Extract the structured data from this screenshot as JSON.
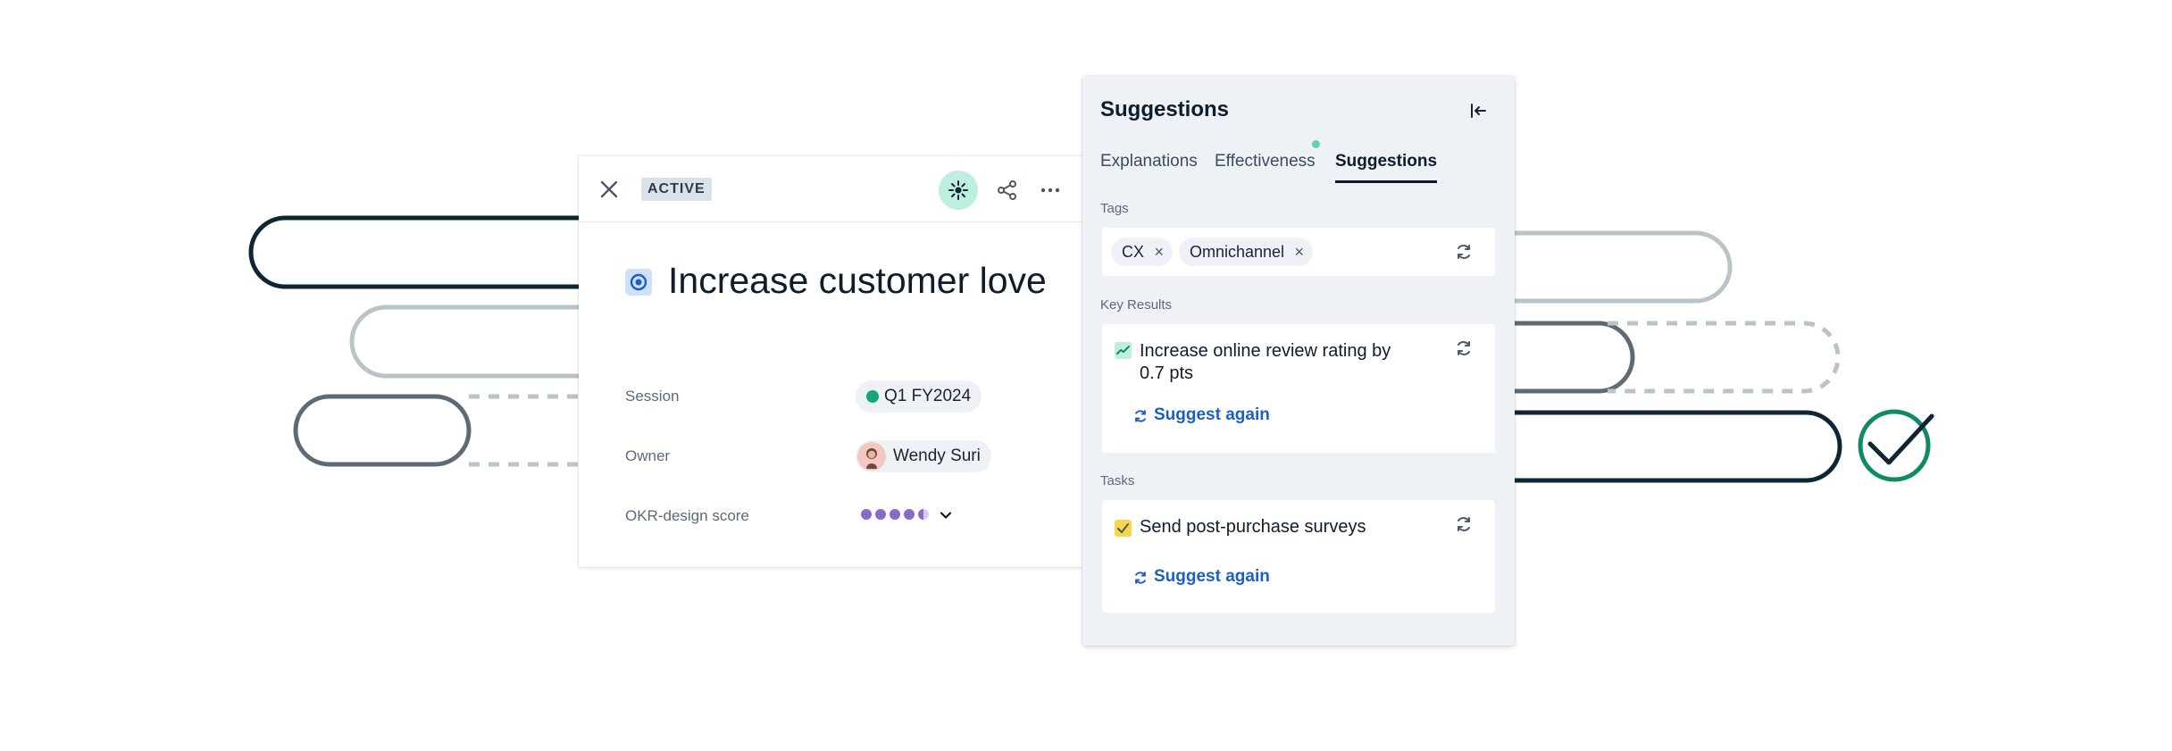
{
  "objective": {
    "status": "ACTIVE",
    "title": "Increase customer love",
    "fields": {
      "session_label": "Session",
      "session_value": "Q1 FY2024",
      "owner_label": "Owner",
      "owner_value": "Wendy Suri",
      "score_label": "OKR-design score",
      "score_value": 4.5,
      "score_max": 5
    },
    "header_icons": [
      "close-icon",
      "sparkle-icon",
      "share-icon",
      "more-icon"
    ]
  },
  "panel": {
    "title": "Suggestions",
    "tabs": [
      {
        "label": "Explanations",
        "active": false
      },
      {
        "label": "Effectiveness",
        "active": false,
        "has_dot": true
      },
      {
        "label": "Suggestions",
        "active": true
      }
    ],
    "tags_label": "Tags",
    "tags": [
      "CX",
      "Omnichannel"
    ],
    "key_results_label": "Key Results",
    "key_result": "Increase online review rating by 0.7 pts",
    "tasks_label": "Tasks",
    "task": "Send post-purchase surveys",
    "suggest_again": "Suggest again"
  },
  "colors": {
    "accent_teal": "#17a57c",
    "link_blue": "#1b5fc7",
    "score_purple": "#8a6bc4",
    "check_green": "#0f8a65",
    "dark_navy": "#0f2533"
  }
}
